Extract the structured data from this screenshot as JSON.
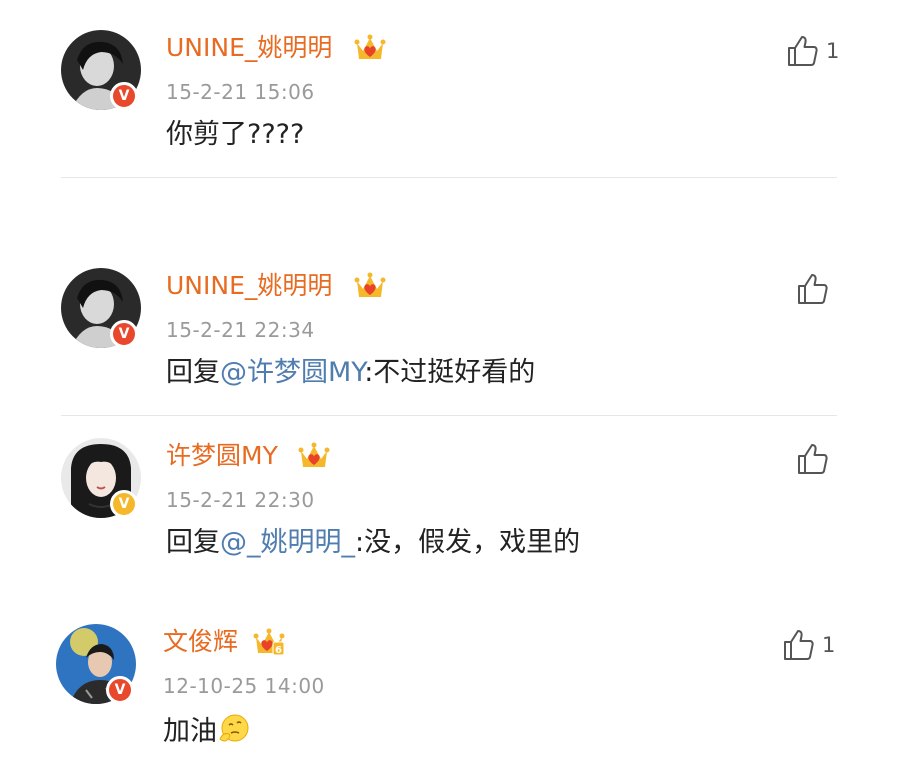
{
  "comments": [
    {
      "username": "UNINE_姚明明",
      "timestamp": "15-2-21 15:06",
      "content": "你剪了????",
      "like_count": "1",
      "badge": "V"
    },
    {
      "username": "UNINE_姚明明",
      "timestamp": "15-2-21 22:34",
      "reply_prefix": "回复",
      "mention": "@许梦圆MY",
      "content": ":不过挺好看的",
      "like_count": "",
      "badge": "V"
    },
    {
      "username": "许梦圆MY",
      "timestamp": "15-2-21 22:30",
      "reply_prefix": "回复",
      "mention": "@_姚明明_",
      "content": ":没，假发，戏里的",
      "like_count": "",
      "badge": "V"
    },
    {
      "username": "文俊辉",
      "timestamp": "12-10-25 14:00",
      "content": "加油",
      "like_count": "1",
      "badge": "V",
      "crown_level": "6"
    }
  ],
  "colors": {
    "username": "#e86b22",
    "mention": "#507daf",
    "timestamp": "#9a9a9a",
    "badge_red": "#e8492c",
    "badge_gold": "#f5b82a",
    "crown_gold": "#f5b82a",
    "crown_red": "#e8432a"
  },
  "icons": {
    "like": "thumbs-up-icon",
    "crown": "vip-crown-icon",
    "verified": "verified-v-badge-icon",
    "emoji": "thinking-face-emoji-icon"
  }
}
